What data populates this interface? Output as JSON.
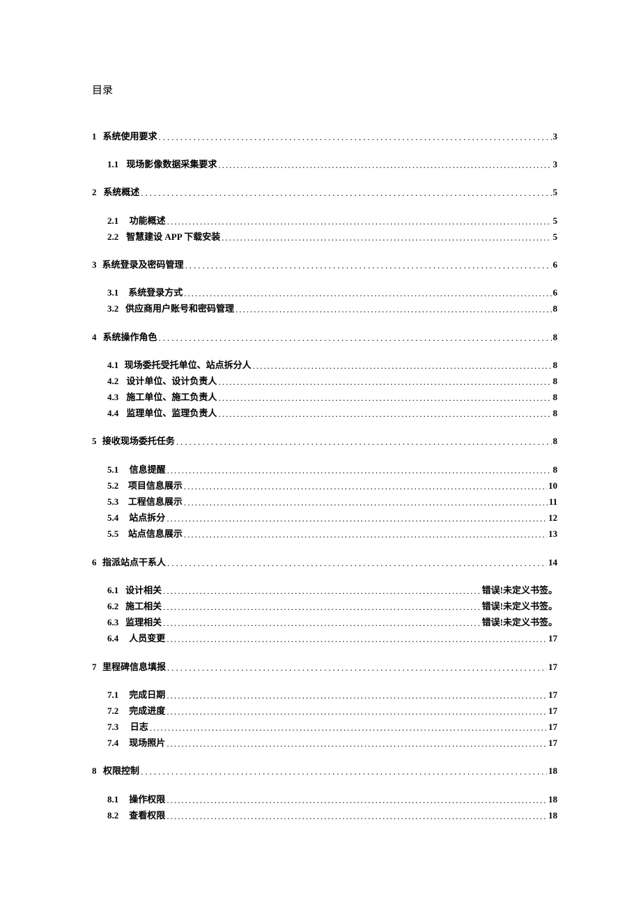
{
  "title": "目录",
  "toc": {
    "sections": [
      {
        "num": "1",
        "label": "系统使用要求",
        "page": "3",
        "children": [
          {
            "num": "1.1",
            "label": "现场影像数据采集要求",
            "page": "3"
          }
        ]
      },
      {
        "num": "2",
        "label": "系统概述",
        "page": "5",
        "children": [
          {
            "num": "2.1",
            "label": "功能概述",
            "page": "5"
          },
          {
            "num": "2.2",
            "label": "智慧建设 APP 下载安装",
            "page": "5"
          }
        ]
      },
      {
        "num": "3",
        "label": "系统登录及密码管理",
        "page": "6",
        "children": [
          {
            "num": "3.1",
            "label": "系统登录方式",
            "page": "6"
          },
          {
            "num": "3.2",
            "label": "供应商用户账号和密码管理",
            "page": "8"
          }
        ]
      },
      {
        "num": "4",
        "label": "系统操作角色",
        "page": "8",
        "children": [
          {
            "num": "4.1",
            "label": "现场委托受托单位、站点拆分人",
            "page": "8"
          },
          {
            "num": "4.2",
            "label": "设计单位、设计负责人",
            "page": "8"
          },
          {
            "num": "4.3",
            "label": "施工单位、施工负责人",
            "page": "8"
          },
          {
            "num": "4.4",
            "label": "监理单位、监理负责人",
            "page": "8"
          }
        ]
      },
      {
        "num": "5",
        "label": "接收现场委托任务",
        "page": "8",
        "children": [
          {
            "num": "5.1",
            "label": "信息提醒",
            "page": "8"
          },
          {
            "num": "5.2",
            "label": "项目信息展示",
            "page": "10"
          },
          {
            "num": "5.3",
            "label": "工程信息展示",
            "page": "11"
          },
          {
            "num": "5.4",
            "label": "站点拆分",
            "page": "12"
          },
          {
            "num": "5.5",
            "label": "站点信息展示",
            "page": "13"
          }
        ]
      },
      {
        "num": "6",
        "label": "指派站点干系人",
        "page": "14",
        "children": [
          {
            "num": "6.1",
            "label": "设计相关",
            "page": "错误!未定义书签。"
          },
          {
            "num": "6.2",
            "label": "施工相关",
            "page": "错误!未定义书签。"
          },
          {
            "num": "6.3",
            "label": "监理相关",
            "page": "错误!未定义书签。"
          },
          {
            "num": "6.4",
            "label": "人员变更",
            "page": "17"
          }
        ]
      },
      {
        "num": "7",
        "label": "里程碑信息填报",
        "page": "17",
        "children": [
          {
            "num": "7.1",
            "label": "完成日期",
            "page": "17"
          },
          {
            "num": "7.2",
            "label": "完成进度",
            "page": "17"
          },
          {
            "num": "7.3",
            "label": "日志",
            "page": "17"
          },
          {
            "num": "7.4",
            "label": "现场照片",
            "page": "17"
          }
        ]
      },
      {
        "num": "8",
        "label": "权限控制",
        "page": "18",
        "children": [
          {
            "num": "8.1",
            "label": "操作权限",
            "page": "18"
          },
          {
            "num": "8.2",
            "label": "查看权限",
            "page": "18"
          }
        ]
      }
    ]
  }
}
